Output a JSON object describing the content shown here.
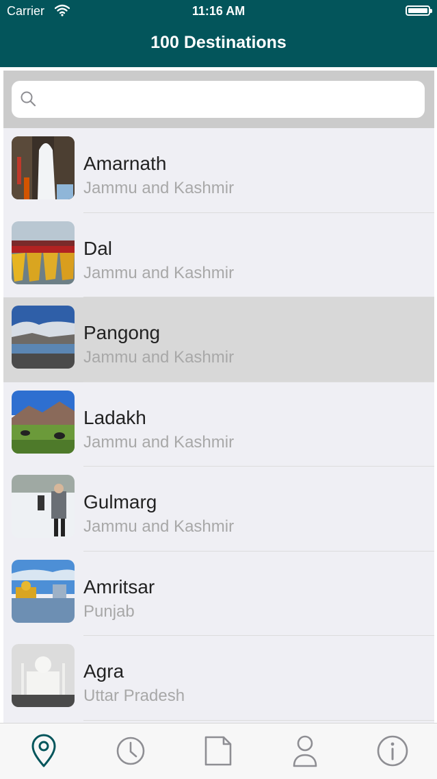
{
  "status_bar": {
    "carrier": "Carrier",
    "time": "11:16 AM"
  },
  "nav": {
    "title": "100 Destinations"
  },
  "search": {
    "placeholder": ""
  },
  "destinations": [
    {
      "name": "Amarnath",
      "region": "Jammu and Kashmir"
    },
    {
      "name": "Dal",
      "region": "Jammu and Kashmir"
    },
    {
      "name": "Pangong",
      "region": "Jammu and Kashmir"
    },
    {
      "name": "Ladakh",
      "region": "Jammu and Kashmir"
    },
    {
      "name": "Gulmarg",
      "region": "Jammu and Kashmir"
    },
    {
      "name": "Amritsar",
      "region": "Punjab"
    },
    {
      "name": "Agra",
      "region": "Uttar Pradesh"
    }
  ],
  "tabs": [
    {
      "icon": "location-pin-icon",
      "active": true
    },
    {
      "icon": "clock-icon",
      "active": false
    },
    {
      "icon": "document-icon",
      "active": false
    },
    {
      "icon": "person-icon",
      "active": false
    },
    {
      "icon": "info-icon",
      "active": false
    }
  ],
  "colors": {
    "header": "#03555b",
    "tab_active": "#03555b",
    "tab_inactive": "#8e8e93"
  }
}
